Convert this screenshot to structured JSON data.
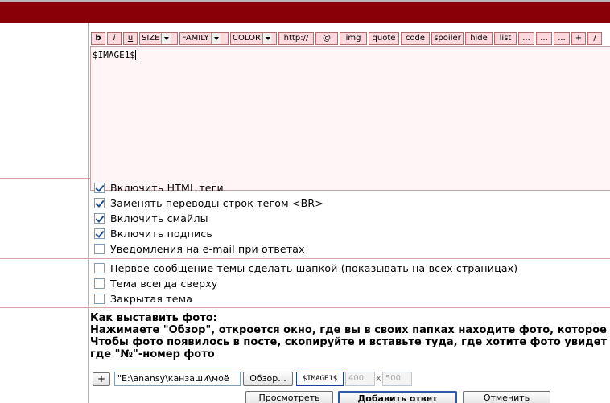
{
  "toolbar": {
    "buttons": [
      "b",
      "i",
      "u",
      "http://",
      "@",
      "img",
      "quote",
      "code",
      "spoiler",
      "hide",
      "list",
      "...",
      "...",
      "...",
      "+",
      "/"
    ],
    "selects": [
      "SIZE",
      "FAMILY",
      "COLOR"
    ]
  },
  "editor": {
    "content": "$IMAGE1$"
  },
  "options": {
    "group1": [
      {
        "label": "Включить HTML теги",
        "checked": true
      },
      {
        "label": "Заменять переводы строк тегом <BR>",
        "checked": true
      },
      {
        "label": "Включить смайлы",
        "checked": true
      },
      {
        "label": "Включить подпись",
        "checked": true
      },
      {
        "label": "Уведомления на e-mail при ответах",
        "checked": false
      }
    ],
    "group2": [
      {
        "label": "Первое сообщение темы сделать шапкой (показывать на всех страницах)",
        "checked": false
      },
      {
        "label": "Тема всегда сверху",
        "checked": false
      },
      {
        "label": "Закрытая тема",
        "checked": false
      }
    ]
  },
  "help": {
    "line1": "Как выставить фото:",
    "line2": "Нажимаете \"Обзор\", откроется окно, где вы в своих папках находите фото, которое х",
    "line3": "Чтобы фото появилось в посте, скопируйте и вставьте туда, где хотите фото увидет",
    "line4": "где \"№\"-номер фото"
  },
  "upload": {
    "plus_label": "+",
    "path_value": "\"E:\\anansy\\канзаши\\моё",
    "browse_label": "Обзор...",
    "tag_value": "$IMAGE1$",
    "width_value": "400",
    "x_label": "X",
    "height_value": "500"
  },
  "actions": {
    "preview_label": "Просмотреть",
    "submit_label": "Добавить ответ",
    "cancel_label": "Отменить"
  },
  "colors": {
    "header": "#8a0008",
    "toolbar_button": "#fbd9dd",
    "editor_bg": "#fff5f6",
    "divider": "#d9a3aa"
  }
}
